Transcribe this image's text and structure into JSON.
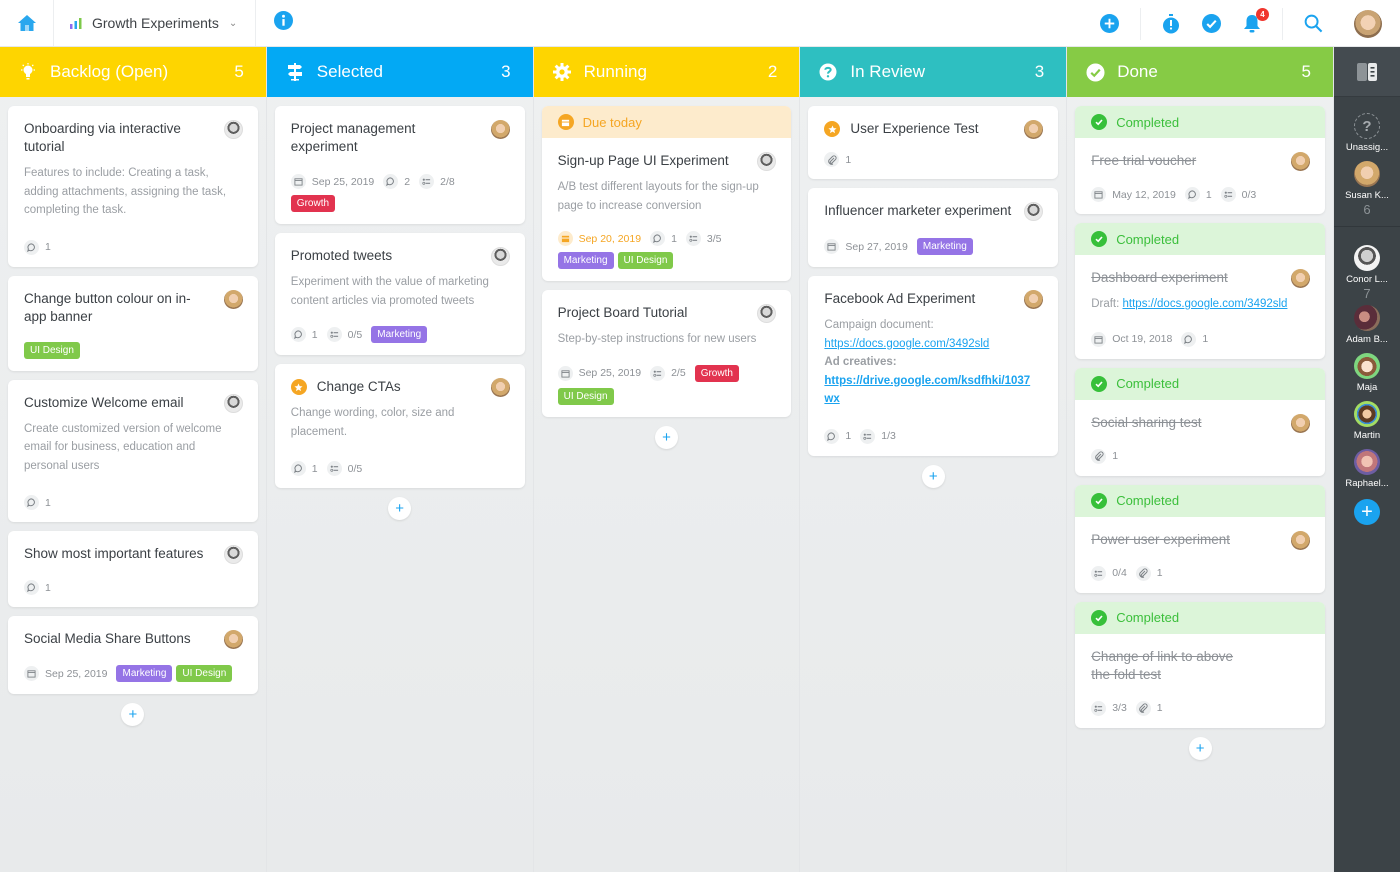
{
  "topbar": {
    "project_name": "Growth Experiments",
    "notification_count": "4",
    "icons": [
      "home-icon",
      "bar-chart-icon",
      "info-icon",
      "add-icon",
      "stopwatch-icon",
      "check-icon",
      "bell-icon",
      "search-icon",
      "user-avatar"
    ]
  },
  "colors": {
    "backlog": "#fed500",
    "selected": "#03a9f4",
    "running": "#fed500",
    "in_review": "#2ebfc1",
    "done": "#86cb45",
    "accent": "#1aa3ef",
    "sidebar": "#3c4347"
  },
  "columns": [
    {
      "title": "Backlog (Open)",
      "count": "5",
      "icon": "lightbulb-icon",
      "cards": [
        {
          "title": "Onboarding via interactive tutorial",
          "desc": "Features to include: Creating a task, adding attachments, assigning the task, completing the task.",
          "comments": "1",
          "avatar": "man"
        },
        {
          "title": "Change button colour on in-app banner",
          "tags": [
            "UI Design"
          ],
          "avatar": "woman"
        },
        {
          "title": "Customize Welcome email",
          "desc": "Create customized version of welcome email for business, education and personal users",
          "comments": "1",
          "avatar": "man"
        },
        {
          "title": "Show most important features",
          "comments": "1",
          "avatar": "man"
        },
        {
          "title": "Social Media Share Buttons",
          "date": "Sep 25, 2019",
          "tags": [
            "Marketing",
            "UI Design"
          ],
          "avatar": "woman"
        }
      ]
    },
    {
      "title": "Selected",
      "count": "3",
      "icon": "signpost-icon",
      "cards": [
        {
          "title": "Project management experiment",
          "date": "Sep 25, 2019",
          "comments": "2",
          "checklist": "2/8",
          "tags": [
            "Growth"
          ],
          "avatar": "woman"
        },
        {
          "title": "Promoted tweets",
          "desc": "Experiment with the value of marketing content articles via promoted tweets",
          "comments": "1",
          "checklist": "0/5",
          "tags": [
            "Marketing"
          ],
          "avatar": "man"
        },
        {
          "title": "Change CTAs",
          "starred": true,
          "desc": "Change wording, color, size and placement.",
          "comments": "1",
          "checklist": "0/5",
          "avatar": "woman"
        }
      ]
    },
    {
      "title": "Running",
      "count": "2",
      "icon": "gear-icon",
      "cards": [
        {
          "banner": "Due today",
          "title": "Sign-up Page UI Experiment",
          "desc": "A/B test different layouts for the sign-up page to increase conversion",
          "date": "Sep 20, 2019",
          "comments": "1",
          "checklist": "3/5",
          "tags": [
            "Marketing",
            "UI Design"
          ],
          "avatar": "man"
        },
        {
          "title": "Project Board Tutorial",
          "desc": "Step-by-step instructions for new users",
          "date": "Sep 25, 2019",
          "checklist": "2/5",
          "tags": [
            "Growth",
            "UI Design"
          ],
          "avatar": "man"
        }
      ]
    },
    {
      "title": "In Review",
      "count": "3",
      "icon": "question-icon",
      "cards": [
        {
          "title": "User Experience Test",
          "starred": true,
          "attachments": "1",
          "avatar": "woman"
        },
        {
          "title": "Influencer marketer experiment",
          "date": "Sep 27, 2019",
          "tags": [
            "Marketing"
          ],
          "avatar": "man"
        },
        {
          "title": "Facebook Ad Experiment",
          "desc_label1": "Campaign document:",
          "link1": "https://docs.google.com/3492sld",
          "desc_label2": "Ad creatives:",
          "link2": "https://drive.google.com/ksdfhki/1037wx",
          "comments": "1",
          "checklist": "1/3",
          "avatar": "woman"
        }
      ]
    },
    {
      "title": "Done",
      "count": "5",
      "icon": "check-circle-icon",
      "cards": [
        {
          "banner": "Completed",
          "title": "Free trial voucher",
          "date": "May 12, 2019",
          "comments": "1",
          "checklist": "0/3",
          "avatar": "woman"
        },
        {
          "banner": "Completed",
          "title": "Dashboard experiment",
          "draft_label": "Draft:",
          "link": "https://docs.google.com/3492sld",
          "date": "Oct 19, 2018",
          "comments": "1",
          "avatar": "woman"
        },
        {
          "banner": "Completed",
          "title": "Social sharing test",
          "attachments": "1",
          "avatar": "woman"
        },
        {
          "banner": "Completed",
          "title": "Power user experiment",
          "checklist": "0/4",
          "attachments": "1",
          "avatar": "woman"
        },
        {
          "banner": "Completed",
          "title": "Change of link to above the fold test",
          "checklist": "3/3",
          "attachments": "1"
        }
      ]
    }
  ],
  "sidebar": {
    "users": [
      {
        "name": "Unassig...",
        "count": ""
      },
      {
        "name": "Susan K...",
        "count": "6"
      },
      {
        "name": "Conor L...",
        "count": "7"
      },
      {
        "name": "Adam B...",
        "count": ""
      },
      {
        "name": "Maja",
        "count": ""
      },
      {
        "name": "Martin",
        "count": ""
      },
      {
        "name": "Raphael...",
        "count": ""
      }
    ],
    "add_label": "+"
  },
  "add_card_label": "+"
}
